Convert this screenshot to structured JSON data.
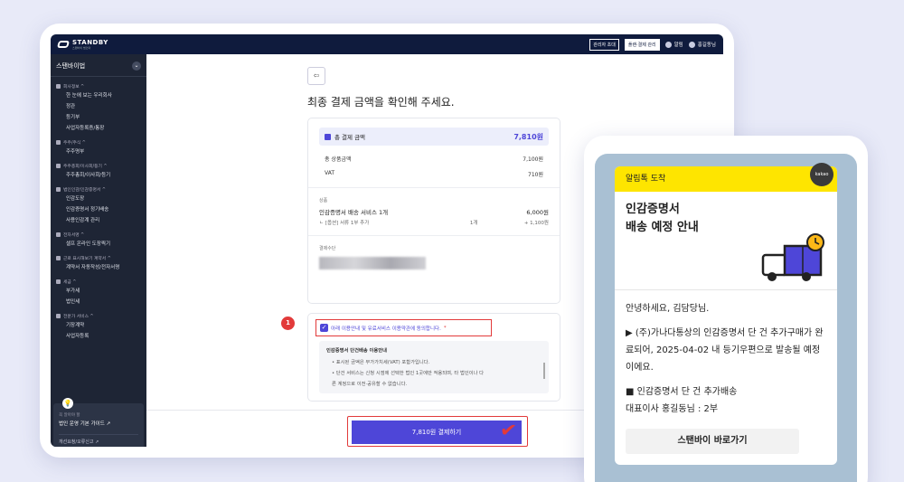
{
  "topbar": {
    "logo": "STANDBY",
    "logo_sub": "스탠바이 법인의",
    "admin_invite": "관리자 초대",
    "billing": "플랜·결제 관리",
    "alerts": "알림",
    "user": "홍길동님"
  },
  "sidebar": {
    "company": "스탠바이법",
    "groups": [
      {
        "title": "회사정보 ^",
        "items": [
          "한 눈에 보는 우리회사",
          "정관",
          "등기부",
          "사업자등록증/통장"
        ]
      },
      {
        "title": "주주/주식 ^",
        "items": [
          "주주명부"
        ]
      },
      {
        "title": "주주총회/이사회/등기 ^",
        "items": [
          "주주총회/이사회/등기"
        ]
      },
      {
        "title": "법인인감/인감증명서 ^",
        "items": [
          "인감도장",
          "인감증명서 정기배송",
          "사용인감계 관리"
        ]
      },
      {
        "title": "전자서명 ^",
        "items": [
          "셀프 온라인 도장찍기"
        ]
      },
      {
        "title": "근로 표시해보기 계약서 ^",
        "items": [
          "계약서 자동작성/전자서명"
        ]
      },
      {
        "title": "세금 ^",
        "items": [
          "부가세",
          "법인세"
        ]
      },
      {
        "title": "전문가 서비스 ^",
        "items": [
          "기장계약",
          "사업자등록"
        ]
      }
    ],
    "card": {
      "hint": "꼭 알아야 할",
      "guide": "법인 운영 기본 가이드 ↗",
      "report": "개선요청/오류신고 ↗"
    }
  },
  "main": {
    "title": "최종 결제 금액을 확인해 주세요.",
    "total_label": "총 결제 금액",
    "total_amount": "7,810원",
    "subtotal_label": "총 상품금액",
    "subtotal_amount": "7,100원",
    "vat_label": "VAT",
    "vat_amount": "710원",
    "product_section": "상품",
    "product_name": "인감증명서 배송 서비스 1개",
    "product_amount": "6,000원",
    "option_name": "ㄴ [옵션] 서류 1부 추가",
    "option_qty": "1개",
    "option_amount": "+ 1,100원",
    "payment_section": "결제수단",
    "agree_text": "아래 이용안내 및 유료서비스 이용약관에 동의합니다.",
    "agree_req": "*",
    "step_badge": "1",
    "notice_title": "인감증명서 단건배송 이용안내",
    "notice_items": [
      "• 표시된 금액은 부가가치세(VAT) 포함가입니다.",
      "• 단건 서비스는 신청 시점에 선택한 법인 1곳에만 적용되며, 타 법인이나 다",
      "른 계정으로 이전·공유할 수 없습니다."
    ],
    "pay_button": "7,810원 결제하기"
  },
  "message": {
    "header": "알림톡 도착",
    "kakao": "kakao",
    "title_line1": "인감증명서",
    "title_line2": "배송 예정 안내",
    "greeting": "안녕하세요, 김담당님.",
    "body": "▶ (주)가나다통상의 인감증명서 단 건 추가구매가 완료되어, 2025-04-02 내 등기우편으로 발송될 예정이에요.",
    "item1": "■ 인감증명서 단 건 추가배송",
    "item2": "대표이사 홍길동님 : 2부",
    "button": "스탠바이 바로가기"
  },
  "colors": {
    "accent": "#4e46d8",
    "navy": "#0f1b3d",
    "highlight": "#e23a3a",
    "kakao_yellow": "#fee500"
  }
}
